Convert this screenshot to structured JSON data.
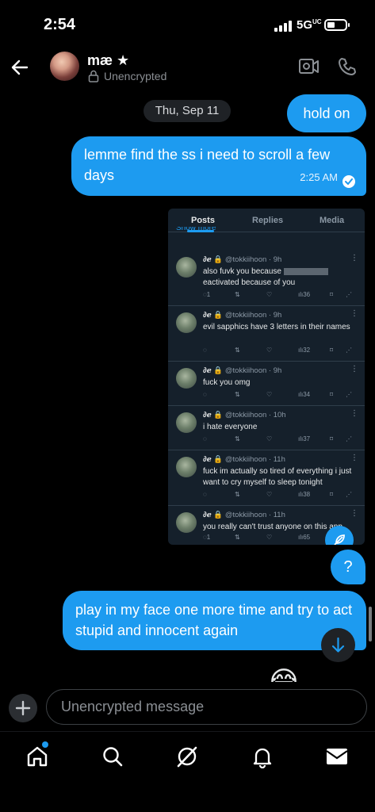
{
  "status_bar": {
    "time": "2:54",
    "network": "5G",
    "network_suffix": "UC",
    "battery_level_fraction": 0.35
  },
  "header": {
    "contact_name": "mæ ★",
    "encryption_label": "Unencrypted"
  },
  "date_separator": "Thu, Sep 11",
  "messages": [
    {
      "text": "hold on"
    },
    {
      "text": "lemme find the ss i need to scroll a few days",
      "time": "2:25 AM"
    },
    {
      "text": "?"
    },
    {
      "text": "play in my face one more time and try to act stupid and innocent again"
    }
  ],
  "screenshot": {
    "tabs": [
      "Posts",
      "Replies",
      "Media"
    ],
    "show_more": "Show more",
    "tweets": [
      {
        "name": "∂ℯ",
        "handle": "@tokkiihoon · 9h",
        "text_before": "also fuvk you because",
        "text_after": "eactivated because of you",
        "replies": "1",
        "views": "36"
      },
      {
        "name": "∂ℯ",
        "handle": "@tokkiihoon · 9h",
        "text": "evil sapphics have 3 letters in their names",
        "replies": "",
        "views": "32"
      },
      {
        "name": "∂ℯ",
        "handle": "@tokkiihoon · 9h",
        "text": "fuck you omg",
        "replies": "",
        "views": "34"
      },
      {
        "name": "∂ℯ",
        "handle": "@tokkiihoon · 10h",
        "text": "i hate everyone",
        "replies": "",
        "views": "37"
      },
      {
        "name": "∂ℯ",
        "handle": "@tokkiihoon · 11h",
        "text": "fuck im actually so tired of everything i just want to cry myself to sleep tonight",
        "replies": "",
        "views": "38"
      },
      {
        "name": "∂ℯ",
        "handle": "@tokkiihoon · 11h",
        "text": "you really can't trust anyone on this app",
        "replies": "1",
        "views": "65"
      }
    ]
  },
  "emoji_partial": "😂",
  "composer": {
    "placeholder": "Unencrypted message"
  },
  "nav": [
    "home-icon",
    "search-icon",
    "grok-icon",
    "bell-icon",
    "mail-icon"
  ],
  "colors": {
    "accent": "#1d9bf0",
    "background": "#000000"
  }
}
